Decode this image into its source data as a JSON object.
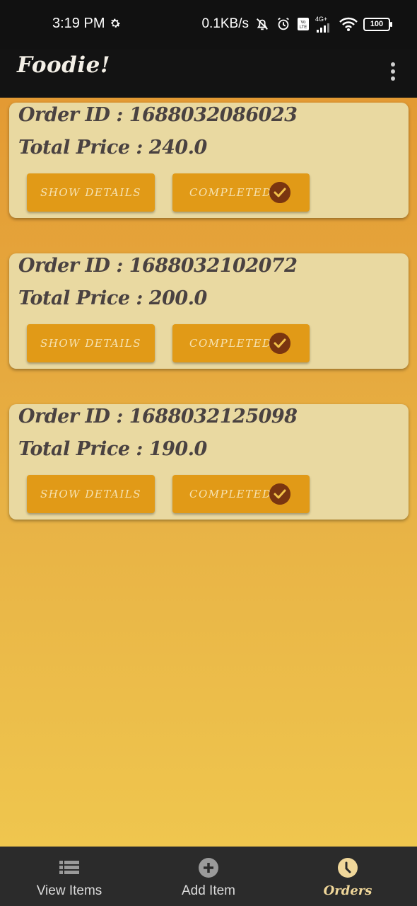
{
  "status_bar": {
    "time": "3:19 PM",
    "network_speed": "0.1KB/s",
    "network_type": "4G+",
    "battery": "100"
  },
  "app_bar": {
    "title": "Foodie!"
  },
  "orders": [
    {
      "id_label": "Order ID : 1688032086023",
      "price_label": "Total Price : 240.0",
      "show_details_label": "Show Details",
      "status_label": "Completed"
    },
    {
      "id_label": "Order ID : 1688032102072",
      "price_label": "Total Price : 200.0",
      "show_details_label": "Show Details",
      "status_label": "Completed"
    },
    {
      "id_label": "Order ID : 1688032125098",
      "price_label": "Total Price : 190.0",
      "show_details_label": "Show Details",
      "status_label": "Completed"
    }
  ],
  "bottom_nav": {
    "items": [
      {
        "label": "View Items",
        "icon": "list-icon"
      },
      {
        "label": "Add Item",
        "icon": "add-circle-icon"
      },
      {
        "label": "Orders",
        "icon": "clock-icon",
        "active": true
      }
    ]
  },
  "colors": {
    "accent": "#e19a17",
    "card": "#e9d9a1",
    "check": "#7a3510"
  }
}
